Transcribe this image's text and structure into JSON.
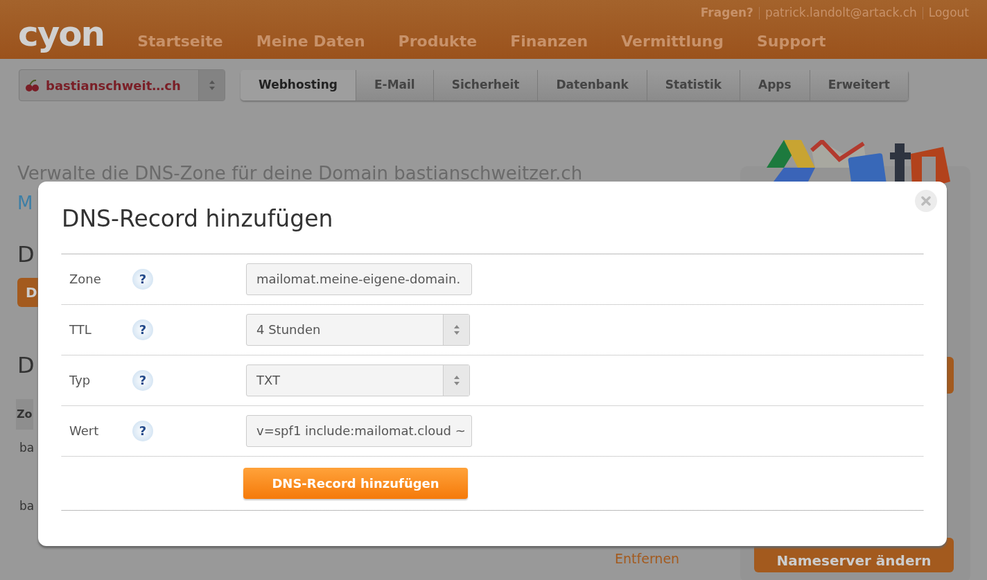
{
  "header": {
    "logo": "cyon",
    "nav": [
      "Startseite",
      "Meine Daten",
      "Produkte",
      "Finanzen",
      "Vermittlung",
      "Support"
    ],
    "user_links": [
      {
        "text": "Fragen?",
        "bold": true
      },
      {
        "text": "patrick.landolt@artack.ch",
        "bold": false
      },
      {
        "text": "Logout",
        "bold": false
      }
    ]
  },
  "domain_select": {
    "value": "bastianschweit…ch"
  },
  "tabs": [
    {
      "label": "Webhosting",
      "selected": true
    },
    {
      "label": "E-Mail",
      "selected": false
    },
    {
      "label": "Sicherheit",
      "selected": false
    },
    {
      "label": "Datenbank",
      "selected": false
    },
    {
      "label": "Statistik",
      "selected": false
    },
    {
      "label": "Apps",
      "selected": false
    },
    {
      "label": "Erweitert",
      "selected": false
    }
  ],
  "background": {
    "intro": "Verwalte die DNS-Zone für deine Domain bastianschweitzer.ch",
    "link": "M",
    "heading_1": "D",
    "button": "D",
    "heading_2": "D",
    "table_header": "Zo",
    "rows": [
      "ba",
      "ba"
    ],
    "remove_link": "Entfernen",
    "nameserver_button": "Nameserver ändern"
  },
  "modal": {
    "title": "DNS-Record hinzufügen",
    "fields": [
      {
        "label": "Zone",
        "help": "?",
        "kind": "text",
        "value": "mailomat.meine-eigene-domain."
      },
      {
        "label": "TTL",
        "help": "?",
        "kind": "select",
        "value": "4 Stunden"
      },
      {
        "label": "Typ",
        "help": "?",
        "kind": "select",
        "value": "TXT"
      },
      {
        "label": "Wert",
        "help": "?",
        "kind": "text",
        "value": "v=spf1 include:mailomat.cloud ~"
      }
    ],
    "submit": "DNS-Record hinzufügen"
  }
}
